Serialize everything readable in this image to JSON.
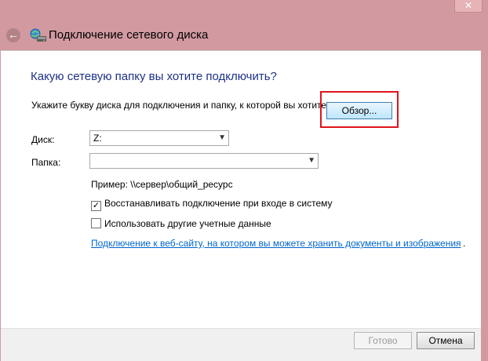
{
  "window": {
    "title": "Подключение сетевого диска",
    "close_glyph": "✕",
    "back_glyph": "←"
  },
  "main": {
    "heading": "Какую сетевую папку вы хотите подключить?",
    "subtitle": "Укажите букву диска для подключения и папку, к которой вы хотите подключиться:",
    "drive_label": "Диск:",
    "drive_value": "Z:",
    "folder_label": "Папка:",
    "folder_value": "",
    "browse_label": "Обзор...",
    "example_text": "Пример: \\\\сервер\\общий_ресурс",
    "reconnect_label": "Восстанавливать подключение при входе в систему",
    "reconnect_checked": true,
    "credentials_label": "Использовать другие учетные данные",
    "credentials_checked": false,
    "website_link": "Подключение к веб-сайту, на котором вы можете хранить документы и изображения",
    "link_period": "."
  },
  "footer": {
    "done_label": "Готово",
    "cancel_label": "Отмена"
  },
  "colors": {
    "chrome": "#d29aa0",
    "heading": "#1e3287",
    "link": "#0066cc",
    "highlight": "#e0141b"
  }
}
